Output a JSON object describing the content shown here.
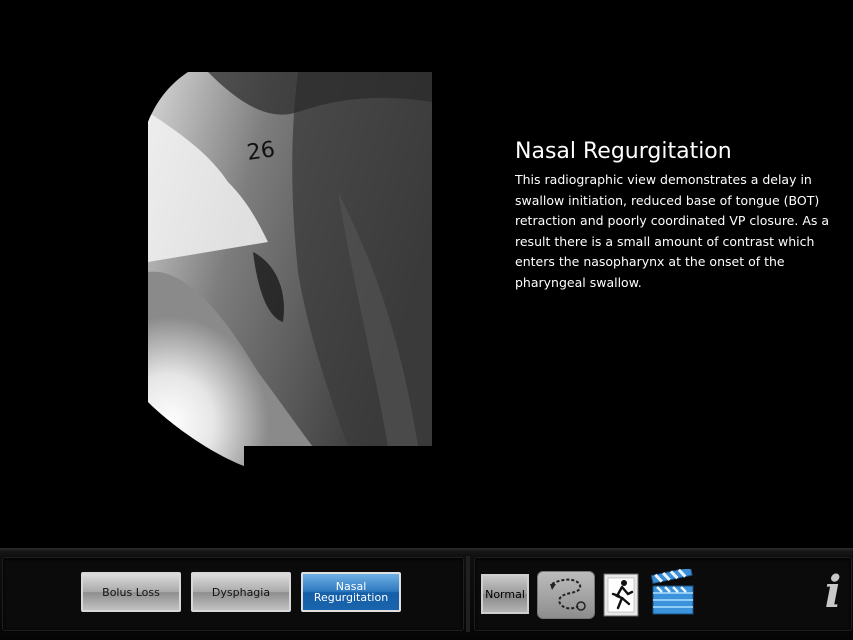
{
  "info": {
    "title": "Nasal Regurgitation",
    "description": "This radiographic view demonstrates a delay in swallow initiation, reduced base of tongue (BOT) retraction and poorly coordinated VP closure.  As a result there is a small amount of contrast which enters the nasopharynx at the onset of the pharyngeal swallow."
  },
  "xray": {
    "marker_label": "26"
  },
  "tabs": [
    {
      "label": "Bolus Loss",
      "active": false
    },
    {
      "label": "Dysphagia",
      "active": false
    },
    {
      "label": "Nasal Regurgitation",
      "active": true,
      "line1": "Nasal",
      "line2": "Regurgitation"
    }
  ],
  "toolbar": {
    "normal_label": "Normal",
    "icons": [
      "swallow-path-icon",
      "runner-icon",
      "clapperboard-icon",
      "info-icon"
    ],
    "info_label": "i"
  },
  "colors": {
    "active_tab": "#1f6cb5",
    "background": "#000000"
  }
}
